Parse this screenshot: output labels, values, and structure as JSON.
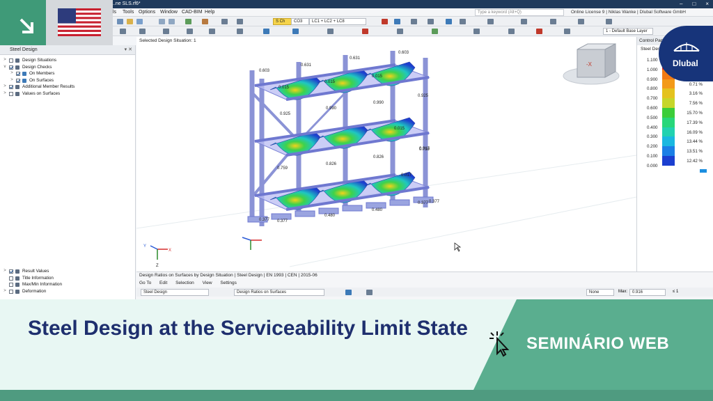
{
  "app": {
    "file_title": "...ne SLS.rf6*",
    "search_placeholder": "Type a keyword (Alt+Q)",
    "license_info": "Online License 9 | Niklas Wanke | Dlubal Software GmbH",
    "window_controls": [
      "–",
      "□",
      "×"
    ]
  },
  "menu": [
    "ls",
    "Tools",
    "Options",
    "Window",
    "CAD-BIM",
    "Help"
  ],
  "toolbar": {
    "design_situation_tag": "S Ch",
    "design_situation": "CO3",
    "load_combination": "LC1 + LC2 + LC8",
    "layer": "1 - Default Base Layer"
  },
  "nav": {
    "title": "Steel Design",
    "items": [
      {
        "label": "Design Situations",
        "level": 0,
        "checked": false,
        "expand": ">"
      },
      {
        "label": "Design Checks",
        "level": 0,
        "checked": true,
        "expand": "v"
      },
      {
        "label": "On Members",
        "level": 1,
        "checked": true,
        "expand": ">"
      },
      {
        "label": "On Surfaces",
        "level": 1,
        "checked": true,
        "expand": ">"
      },
      {
        "label": "Additional Member Results",
        "level": 0,
        "checked": true,
        "expand": ">"
      },
      {
        "label": "Values on Surfaces",
        "level": 0,
        "checked": false,
        "expand": ">"
      }
    ],
    "bottom_items": [
      {
        "label": "Result Values",
        "checked": true,
        "expand": ">"
      },
      {
        "label": "Title Information",
        "checked": false,
        "expand": ""
      },
      {
        "label": "Max/Min Information",
        "checked": false,
        "expand": ""
      },
      {
        "label": "Deformation",
        "checked": false,
        "expand": ">"
      }
    ]
  },
  "viewport": {
    "header": "Selected Design Situation: 1",
    "value_labels": [
      "0.603",
      "0.631",
      "0.631",
      "0.603",
      "0.925",
      "0.990",
      "0.990",
      "0.925",
      "0.015",
      "0.015",
      "0.015",
      "0.015",
      "0.017",
      "0.017",
      "0.759",
      "0.826",
      "0.826",
      "0.759",
      "0.377",
      "0.480",
      "0.480",
      "0.377",
      "0.377",
      "0.377"
    ],
    "axis_labels": {
      "x": "X",
      "y": "Y",
      "z": "Z"
    },
    "nav_cube_label": "-X"
  },
  "control_panel": {
    "title": "Control Panel",
    "subtitle": "Steel Design",
    "legend": [
      {
        "value": "1.100",
        "pct": "",
        "color": "#e0201a"
      },
      {
        "value": "1.000",
        "pct": "",
        "color": "#f07a14"
      },
      {
        "value": "0.900",
        "pct": "0.71 %",
        "color": "#f39a18"
      },
      {
        "value": "0.800",
        "pct": "3.16 %",
        "color": "#e4c21e"
      },
      {
        "value": "0.700",
        "pct": "7.56 %",
        "color": "#c6d62a"
      },
      {
        "value": "0.600",
        "pct": "15.70 %",
        "color": "#3ccd3a"
      },
      {
        "value": "0.500",
        "pct": "17.39 %",
        "color": "#28d77a"
      },
      {
        "value": "0.400",
        "pct": "16.09 %",
        "color": "#22d2b0"
      },
      {
        "value": "0.300",
        "pct": "13.44 %",
        "color": "#1ab8e0"
      },
      {
        "value": "0.200",
        "pct": "13.51 %",
        "color": "#1b7fe6"
      },
      {
        "value": "0.100",
        "pct": "12.42 %",
        "color": "#1b3fd0"
      },
      {
        "value": "0.000",
        "pct": "",
        "color": "#0d1f9a"
      }
    ]
  },
  "table": {
    "title": "Design Ratios on Surfaces by Design Situation | Steel Design | EN 1993 | CEN | 2015-06",
    "menu": [
      "Go To",
      "Edit",
      "Selection",
      "View",
      "Settings"
    ],
    "module_select": "Steel Design",
    "result_select": "Design Ratios on Surfaces",
    "filter_select": "None",
    "max_label": "Max:",
    "max_value": "0.916",
    "le_label": "≤ 1"
  },
  "banner": {
    "headline": "Steel Design at the Serviceability Limit State",
    "tag": "SEMINÁRIO WEB",
    "brand": "Dlubal"
  }
}
